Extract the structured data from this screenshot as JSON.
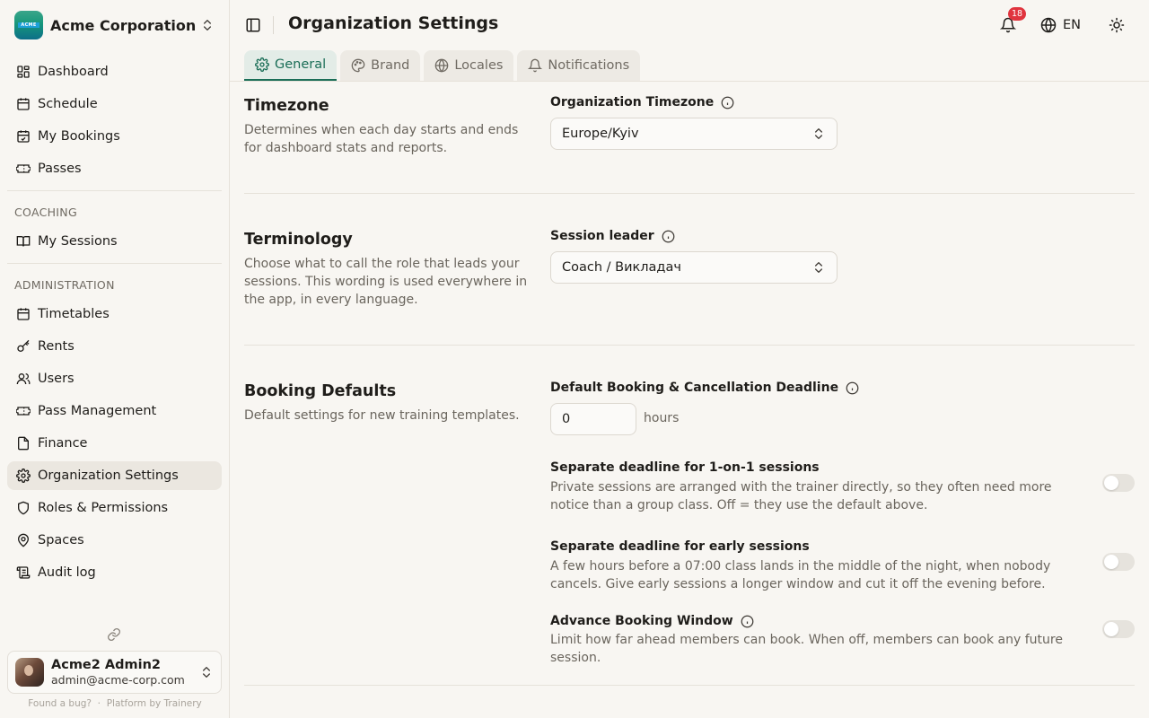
{
  "org": {
    "name": "Acme Corporation",
    "logo_text": "ACME"
  },
  "nav": {
    "main": [
      {
        "label": "Dashboard",
        "icon": "dashboard-icon"
      },
      {
        "label": "Schedule",
        "icon": "calendar-icon"
      },
      {
        "label": "My Bookings",
        "icon": "calendar-check-icon"
      },
      {
        "label": "Passes",
        "icon": "ticket-icon"
      }
    ],
    "coaching_label": "COACHING",
    "coaching": [
      {
        "label": "My Sessions",
        "icon": "book-open-icon"
      }
    ],
    "admin_label": "ADMINISTRATION",
    "admin": [
      {
        "label": "Timetables",
        "icon": "calendar-grid-icon"
      },
      {
        "label": "Rents",
        "icon": "key-icon"
      },
      {
        "label": "Users",
        "icon": "users-icon"
      },
      {
        "label": "Pass Management",
        "icon": "ticket-icon"
      },
      {
        "label": "Finance",
        "icon": "file-icon"
      },
      {
        "label": "Organization Settings",
        "icon": "settings-icon",
        "active": true
      },
      {
        "label": "Roles & Permissions",
        "icon": "shield-icon"
      },
      {
        "label": "Spaces",
        "icon": "map-pin-icon"
      },
      {
        "label": "Audit log",
        "icon": "scroll-icon"
      }
    ]
  },
  "user": {
    "name": "Acme2 Admin2",
    "email": "admin@acme-corp.com"
  },
  "footer": {
    "bug": "Found a bug?",
    "separator": "·",
    "platform": "Platform by Trainery"
  },
  "header": {
    "title": "Organization Settings",
    "notifications_count": "18",
    "language": "EN"
  },
  "tabs": [
    {
      "label": "General",
      "icon": "settings-icon",
      "active": true
    },
    {
      "label": "Brand",
      "icon": "palette-icon"
    },
    {
      "label": "Locales",
      "icon": "globe-icon"
    },
    {
      "label": "Notifications",
      "icon": "bell-icon"
    }
  ],
  "timezone": {
    "title": "Timezone",
    "description": "Determines when each day starts and ends for dashboard stats and reports.",
    "field_label": "Organization Timezone",
    "value": "Europe/Kyiv"
  },
  "terminology": {
    "title": "Terminology",
    "description": "Choose what to call the role that leads your sessions. This wording is used everywhere in the app, in every language.",
    "field_label": "Session leader",
    "value": "Coach / Викладач"
  },
  "booking": {
    "title": "Booking Defaults",
    "description": "Default settings for new training templates.",
    "deadline_label": "Default Booking & Cancellation Deadline",
    "deadline_value": "0",
    "deadline_unit": "hours",
    "options": [
      {
        "title": "Separate deadline for 1-on-1 sessions",
        "description": "Private sessions are arranged with the trainer directly, so they often need more notice than a group class. Off = they use the default above.",
        "enabled": false
      },
      {
        "title": "Separate deadline for early sessions",
        "description": "A few hours before a 07:00 class lands in the middle of the night, when nobody cancels. Give early sessions a longer window and cut it off the evening before.",
        "enabled": false
      },
      {
        "title": "Advance Booking Window",
        "description": "Limit how far ahead members can book. When off, members can book any future session.",
        "enabled": false
      }
    ]
  }
}
